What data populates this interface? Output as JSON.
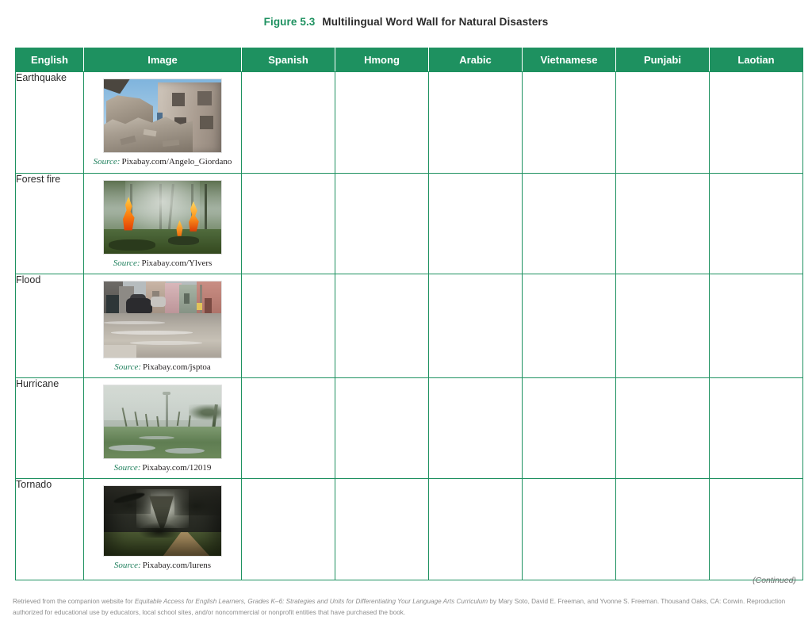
{
  "figure": {
    "number": "Figure 5.3",
    "caption": "Multilingual Word Wall for Natural Disasters"
  },
  "table": {
    "headers": [
      "English",
      "Image",
      "Spanish",
      "Hmong",
      "Arabic",
      "Vietnamese",
      "Punjabi",
      "Laotian"
    ],
    "source_label": "Source:",
    "rows": [
      {
        "english": "Earthquake",
        "image_alt": "earthquake-photo",
        "source_credit": "Pixabay.com/Angelo_Giordano",
        "spanish": "",
        "hmong": "",
        "arabic": "",
        "vietnamese": "",
        "punjabi": "",
        "laotian": ""
      },
      {
        "english": "Forest fire",
        "image_alt": "forest-fire-photo",
        "source_credit": "Pixabay.com/Ylvers",
        "spanish": "",
        "hmong": "",
        "arabic": "",
        "vietnamese": "",
        "punjabi": "",
        "laotian": ""
      },
      {
        "english": "Flood",
        "image_alt": "flood-photo",
        "source_credit": "Pixabay.com/jsptoa",
        "spanish": "",
        "hmong": "",
        "arabic": "",
        "vietnamese": "",
        "punjabi": "",
        "laotian": ""
      },
      {
        "english": "Hurricane",
        "image_alt": "hurricane-photo",
        "source_credit": "Pixabay.com/12019",
        "spanish": "",
        "hmong": "",
        "arabic": "",
        "vietnamese": "",
        "punjabi": "",
        "laotian": ""
      },
      {
        "english": "Tornado",
        "image_alt": "tornado-photo",
        "source_credit": "Pixabay.com/lurens",
        "spanish": "",
        "hmong": "",
        "arabic": "",
        "vietnamese": "",
        "punjabi": "",
        "laotian": ""
      }
    ]
  },
  "continued_note": "(Continued)",
  "footer": {
    "part1": "Retrieved from the companion website for ",
    "book_title": "Equitable Access for English Learners, Grades K–6: Strategies and Units for Differentiating Your Language Arts Curriculum",
    "part2": " by Mary Soto, David E. Freeman, and Yvonne S. Freeman. Thousand Oaks, CA: Corwin. Reproduction authorized for educational use by educators, local school sites, and/or noncommercial or nonprofit entities that have purchased the book."
  },
  "colors": {
    "brand_green": "#1e9160",
    "source_green": "#1e7f5c",
    "text_dark": "#2b2b2b",
    "footer_gray": "#8d8d8d"
  }
}
